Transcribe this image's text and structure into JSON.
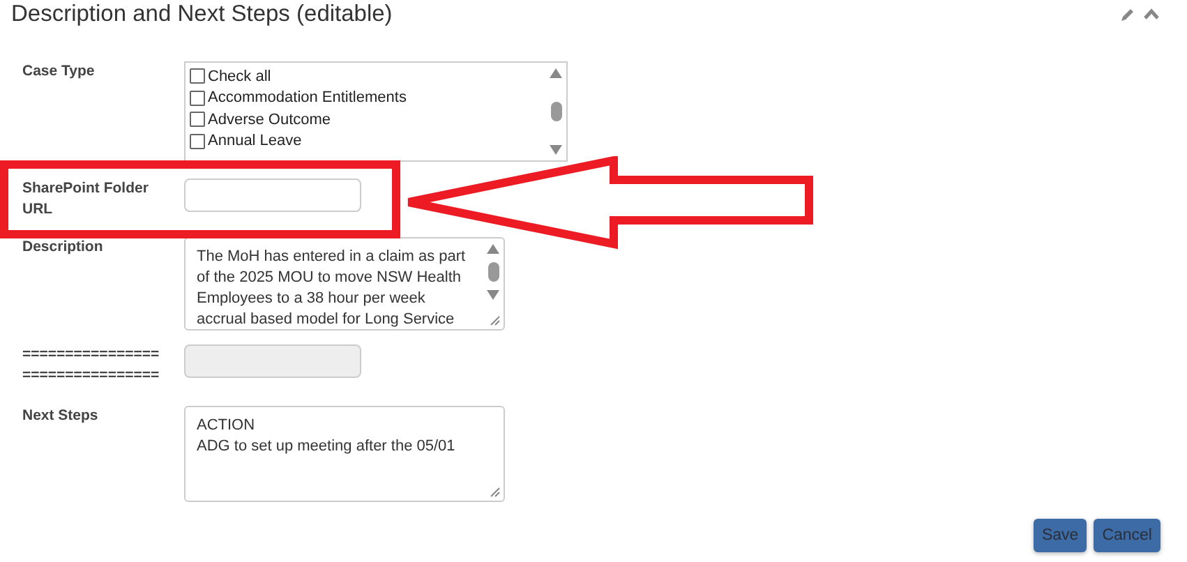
{
  "panel": {
    "title": "Description and Next Steps (editable)"
  },
  "case_type": {
    "label": "Case Type",
    "options": [
      {
        "label": "Check all",
        "checked": false
      },
      {
        "label": "Accommodation Entitlements",
        "checked": false
      },
      {
        "label": "Adverse Outcome",
        "checked": false
      },
      {
        "label": "Annual Leave",
        "checked": false
      }
    ]
  },
  "sharepoint": {
    "label": "SharePoint Folder URL"
  },
  "description": {
    "label": "Description",
    "value": "The MoH has entered in a claim as part\nof the 2025 MOU to move NSW Health\nEmployees to a 38 hour per week\naccrual based model for Long Service"
  },
  "separator": {
    "label": "================ ================",
    "disabled": true
  },
  "next_steps": {
    "label": "Next Steps",
    "value": "ACTION\nADG to set up meeting after the 05/01"
  },
  "buttons": [
    "Save",
    "Cancel"
  ]
}
